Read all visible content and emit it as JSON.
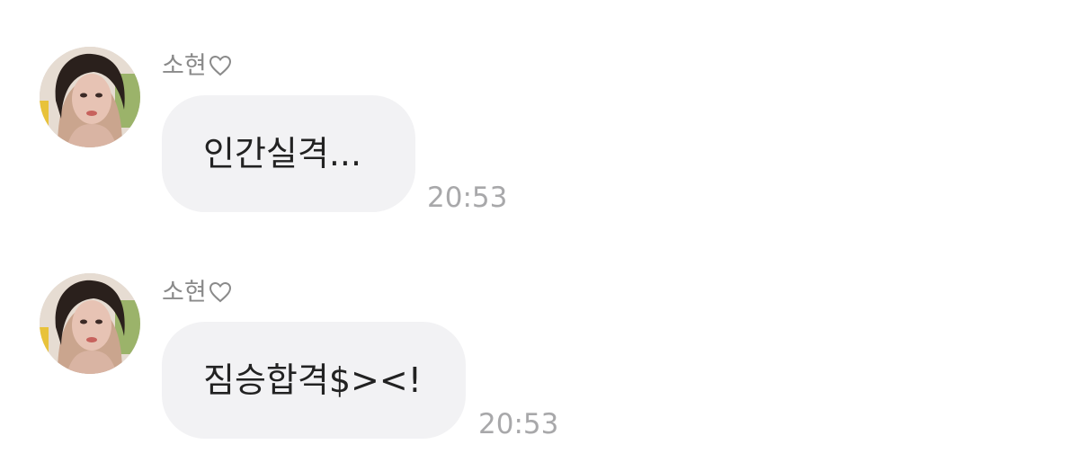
{
  "messages": [
    {
      "sender": "소현",
      "sender_badge_icon": "heart-outline-icon",
      "avatar_icon": "profile-photo-avatar",
      "text": "인간실격...",
      "time": "20:53"
    },
    {
      "sender": "소현",
      "sender_badge_icon": "heart-outline-icon",
      "avatar_icon": "profile-photo-avatar",
      "text": "짐승합격$><!",
      "time": "20:53"
    }
  ],
  "colors": {
    "background": "#ffffff",
    "bubble": "#f2f2f4",
    "sender_text": "#8a8a8a",
    "message_text": "#222222",
    "timestamp": "#a8a8aa"
  }
}
